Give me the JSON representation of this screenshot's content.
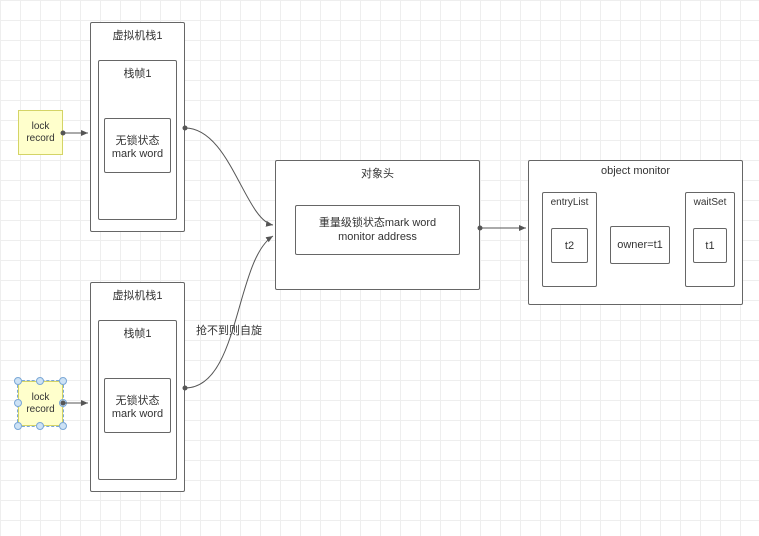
{
  "vm1": {
    "title": "虚拟机栈1",
    "frame_title": "栈帧1",
    "mark1": "无锁状态",
    "mark2": "mark word"
  },
  "vm2": {
    "title": "虚拟机栈1",
    "frame_title": "栈帧1",
    "mark1": "无锁状态",
    "mark2": "mark word"
  },
  "note1": {
    "text1": "lock",
    "text2": "record"
  },
  "note2": {
    "text1": "lock",
    "text2": "record"
  },
  "objheader": {
    "title": "对象头",
    "mark1": "重量级锁状态mark word",
    "mark2": "monitor address"
  },
  "monitor": {
    "title": "object monitor",
    "entryList_label": "entryList",
    "entry_item": "t2",
    "owner": "owner=t1",
    "waitSet_label": "waitSet",
    "wait_item": "t1"
  },
  "edge_label": "抢不到则自旋",
  "chart_data": {
    "type": "diagram",
    "nodes": [
      {
        "id": "note1",
        "label": "lock record",
        "kind": "note"
      },
      {
        "id": "vm1",
        "label": "虚拟机栈1",
        "children": [
          {
            "id": "frame1",
            "label": "栈帧1",
            "children": [
              {
                "id": "mark1",
                "label": "无锁状态 mark word"
              }
            ]
          }
        ]
      },
      {
        "id": "note2",
        "label": "lock record",
        "kind": "note",
        "selected": true
      },
      {
        "id": "vm2",
        "label": "虚拟机栈1",
        "children": [
          {
            "id": "frame2",
            "label": "栈帧1",
            "children": [
              {
                "id": "mark2",
                "label": "无锁状态 mark word"
              }
            ]
          }
        ]
      },
      {
        "id": "objheader",
        "label": "对象头",
        "children": [
          {
            "id": "hw_mark",
            "label": "重量级锁状态mark word monitor address"
          }
        ]
      },
      {
        "id": "monitor",
        "label": "object monitor",
        "children": [
          {
            "id": "entryList",
            "label": "entryList",
            "children": [
              {
                "id": "t2",
                "label": "t2"
              }
            ]
          },
          {
            "id": "owner",
            "label": "owner=t1"
          },
          {
            "id": "waitSet",
            "label": "waitSet",
            "children": [
              {
                "id": "t1",
                "label": "t1"
              }
            ]
          }
        ]
      }
    ],
    "edges": [
      {
        "from": "note1",
        "to": "vm1"
      },
      {
        "from": "note2",
        "to": "vm2"
      },
      {
        "from": "vm1",
        "to": "objheader"
      },
      {
        "from": "vm2",
        "to": "objheader",
        "label": "抢不到则自旋"
      },
      {
        "from": "objheader",
        "to": "monitor"
      }
    ]
  }
}
